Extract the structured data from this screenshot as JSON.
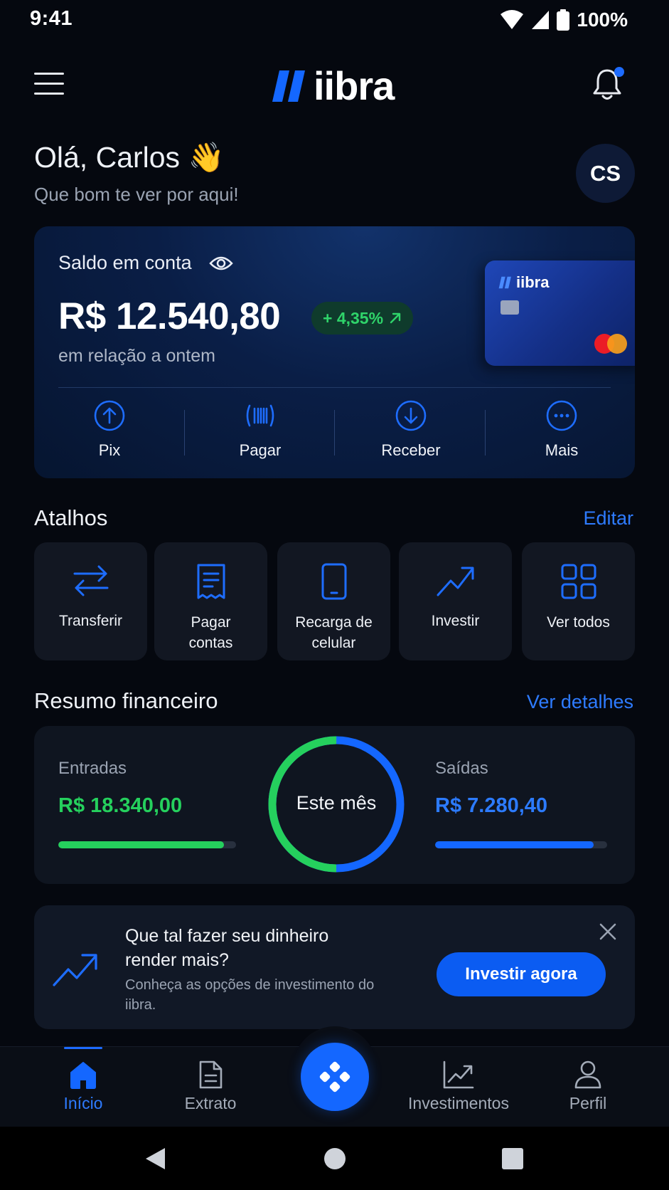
{
  "status_bar": {
    "time": "9:41",
    "battery": "100%"
  },
  "header": {
    "logo_text": "iibra"
  },
  "greeting": {
    "title": "Olá, Carlos 👋",
    "subtitle": "Que bom te ver por aqui!",
    "avatar_initials": "CS"
  },
  "balance": {
    "label": "Saldo em conta",
    "amount": "R$ 12.540,80",
    "change": "+ 4,35%",
    "change_caption": "em relação a ontem",
    "card_brand": "iibra",
    "actions": [
      {
        "label": "Pix",
        "icon": "arrow-up-circle-icon"
      },
      {
        "label": "Pagar",
        "icon": "barcode-icon"
      },
      {
        "label": "Receber",
        "icon": "arrow-down-circle-icon"
      },
      {
        "label": "Mais",
        "icon": "more-circle-icon"
      }
    ]
  },
  "shortcuts": {
    "title": "Atalhos",
    "edit_label": "Editar",
    "items": [
      {
        "label": "Transferir",
        "icon": "transfer-arrows-icon"
      },
      {
        "label": "Pagar\ncontas",
        "icon": "receipt-icon"
      },
      {
        "label": "Recarga de\ncelular",
        "icon": "smartphone-icon"
      },
      {
        "label": "Investir",
        "icon": "trending-up-icon"
      },
      {
        "label": "Ver todos",
        "icon": "grid-icon"
      }
    ]
  },
  "summary": {
    "title": "Resumo financeiro",
    "details_label": "Ver detalhes",
    "income_label": "Entradas",
    "income_value": "R$ 18.340,00",
    "income_progress": 0.93,
    "expense_label": "Saídas",
    "expense_value": "R$ 7.280,40",
    "expense_progress": 0.92,
    "period_label": "Este mês",
    "donut_income_share": 0.5,
    "colors": {
      "income": "#25d05d",
      "expense": "#1467ff"
    }
  },
  "promo": {
    "title": "Que tal fazer seu dinheiro render mais?",
    "description": "Conheça as opções de investimento do iibra.",
    "cta": "Investir agora",
    "icon": "trending-up-icon"
  },
  "bottom_nav": {
    "items": [
      {
        "label": "Início",
        "icon": "home-icon",
        "active": true
      },
      {
        "label": "Extrato",
        "icon": "document-icon",
        "active": false
      },
      {
        "label": "Investimentos",
        "icon": "chart-line-icon",
        "active": false
      },
      {
        "label": "Perfil",
        "icon": "user-icon",
        "active": false
      }
    ],
    "center_icon": "diamond-grid-icon"
  },
  "accent_color": "#1d6bff"
}
